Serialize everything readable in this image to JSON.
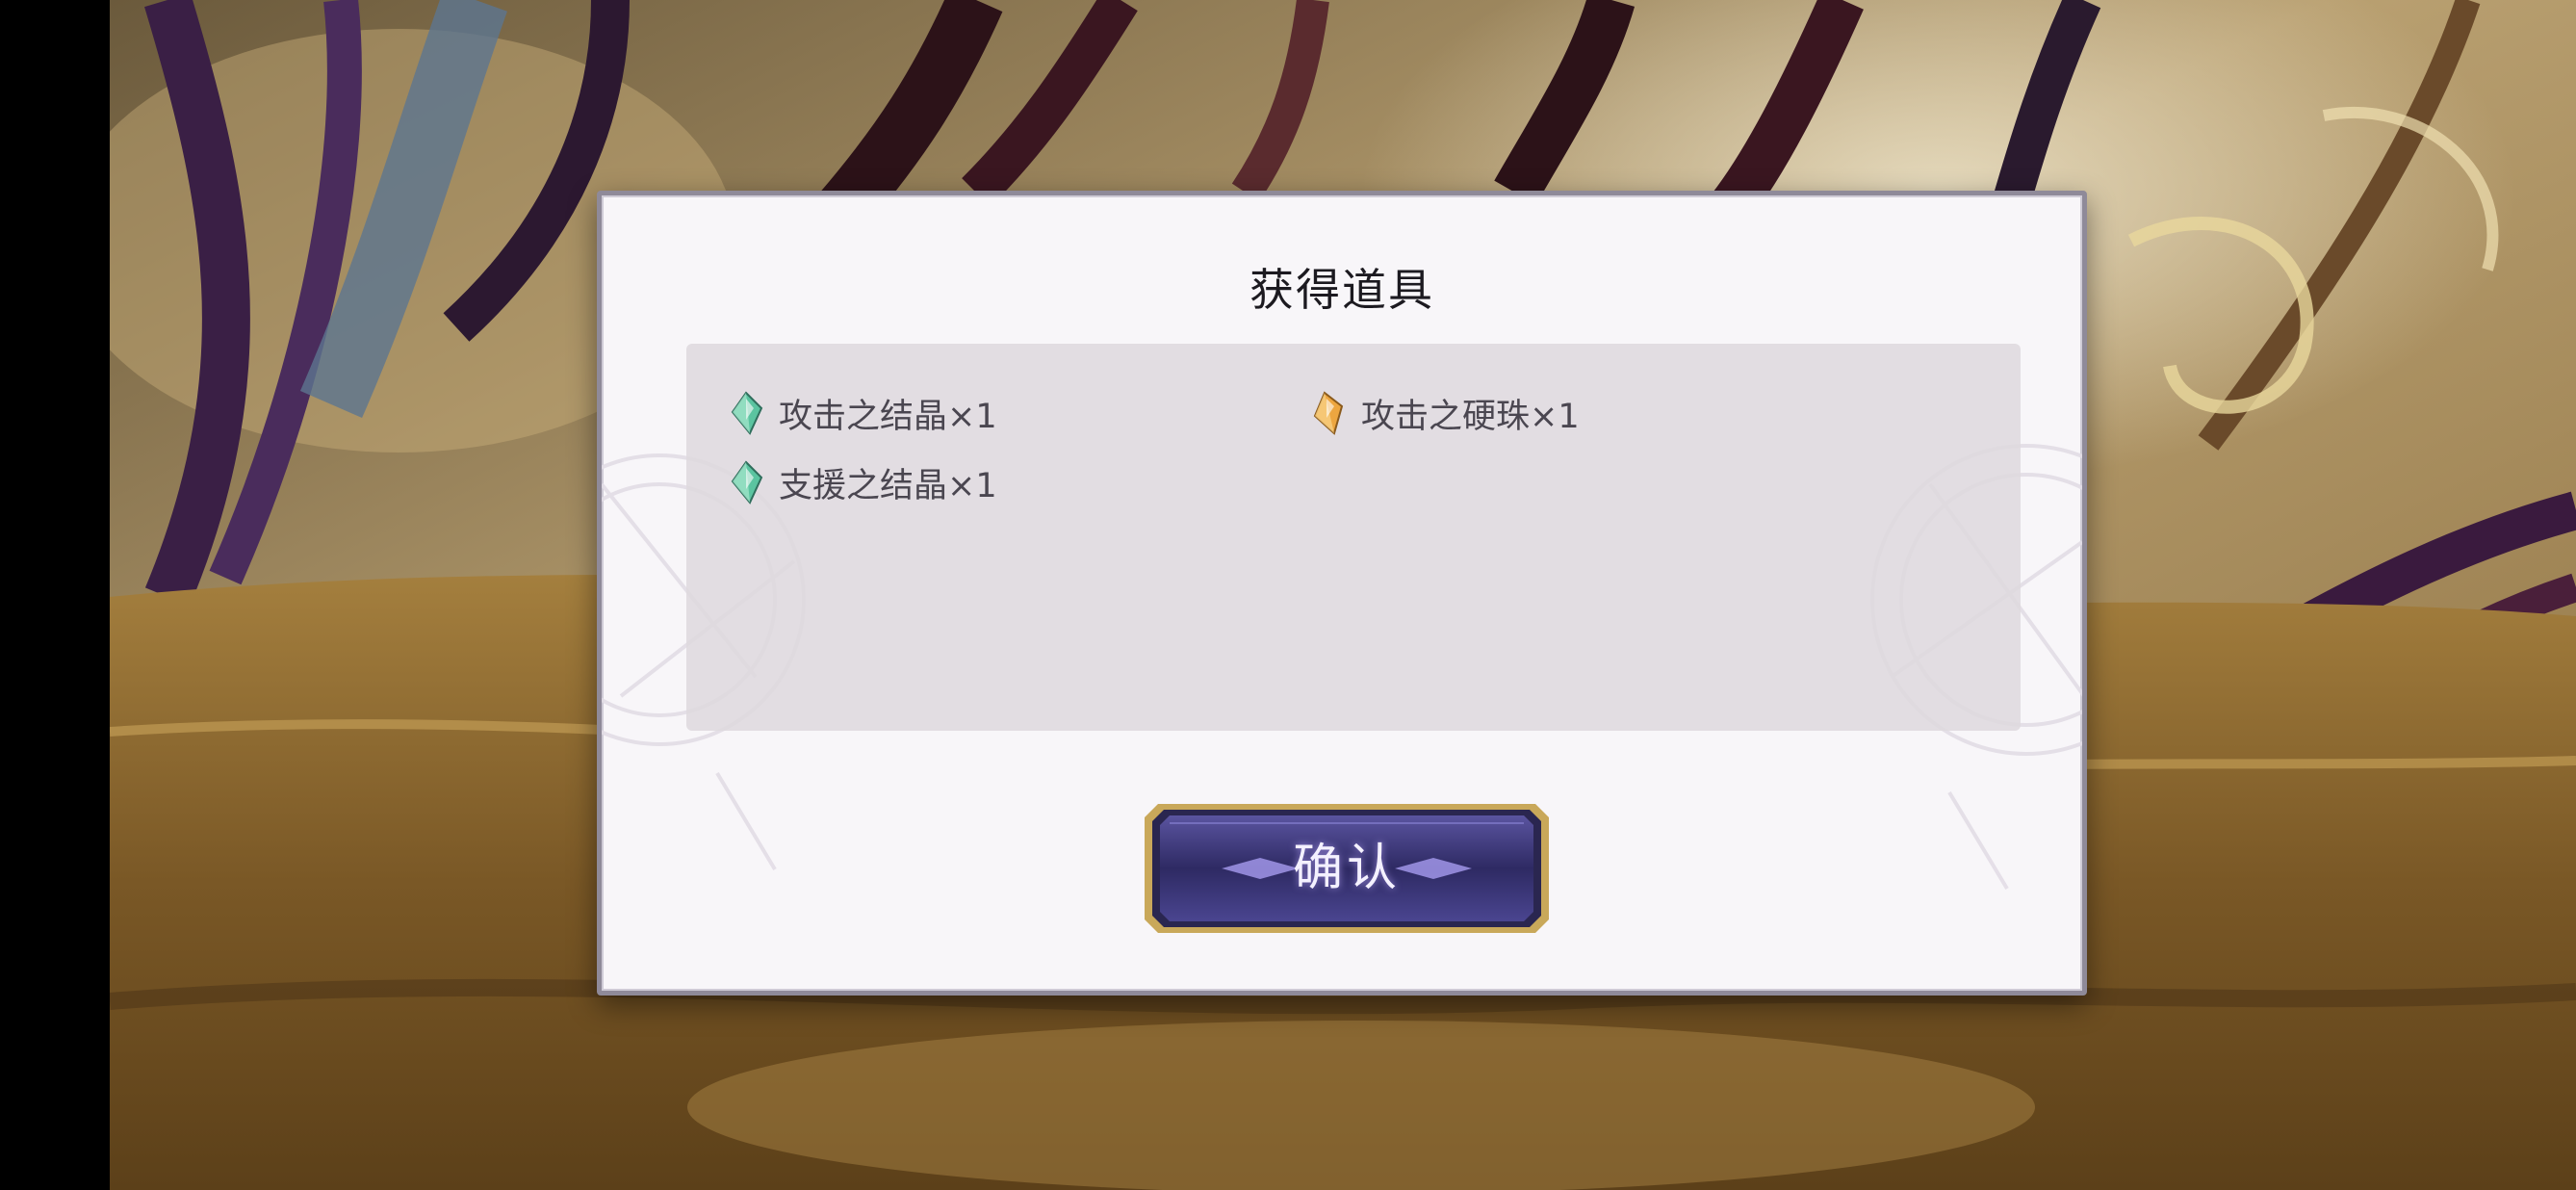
{
  "dialog": {
    "title": "获得道具",
    "rewards": [
      {
        "label": "攻击之结晶×1",
        "icon": "green-crystal-icon",
        "color": "#4fbf9a"
      },
      {
        "label": "攻击之硬珠×1",
        "icon": "orange-gem-icon",
        "color": "#e8a43a"
      },
      {
        "label": "支援之结晶×1",
        "icon": "green-crystal-icon",
        "color": "#4fbf9a"
      }
    ],
    "confirm_label": "确认"
  },
  "colors": {
    "button_fill": "#3a3570",
    "button_border": "#c9a85a",
    "panel_bg": "#dedade"
  }
}
